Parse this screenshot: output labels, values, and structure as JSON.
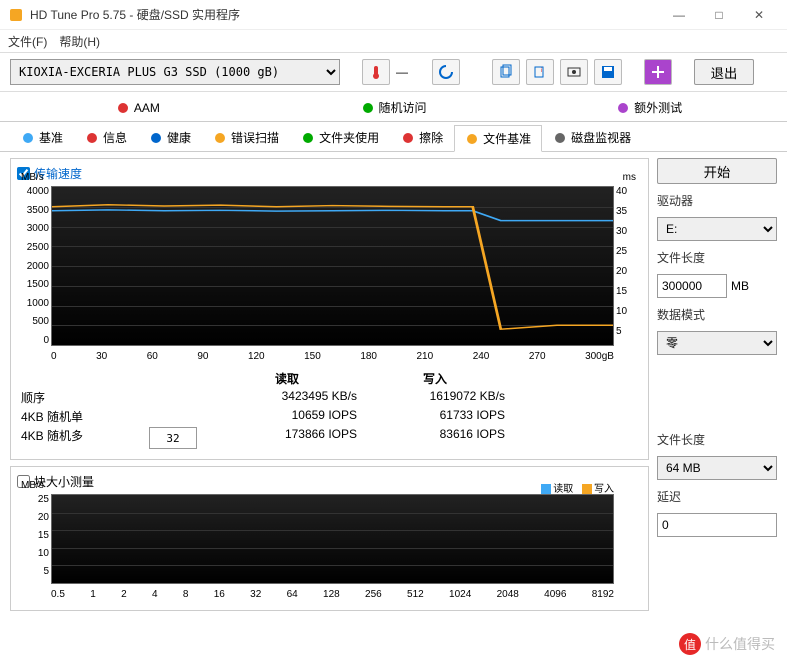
{
  "window": {
    "title": "HD Tune Pro 5.75 - 硬盘/SSD 实用程序",
    "min": "—",
    "max": "□",
    "close": "✕"
  },
  "menu": {
    "file": "文件(F)",
    "help": "帮助(H)"
  },
  "toolbar": {
    "drive": "KIOXIA-EXCERIA PLUS G3 SSD (1000 gB)",
    "exit": "退出"
  },
  "tabs_row1": [
    {
      "icon": "speaker-icon",
      "label": "AAM"
    },
    {
      "icon": "random-icon",
      "label": "随机访问"
    },
    {
      "icon": "extra-icon",
      "label": "额外测试"
    }
  ],
  "tabs_row2": [
    {
      "icon": "bulb-icon",
      "label": "基准"
    },
    {
      "icon": "info-icon",
      "label": "信息"
    },
    {
      "icon": "health-icon",
      "label": "健康"
    },
    {
      "icon": "scan-icon",
      "label": "错误扫描"
    },
    {
      "icon": "folder-icon",
      "label": "文件夹使用"
    },
    {
      "icon": "erase-icon",
      "label": "擦除"
    },
    {
      "icon": "filebench-icon",
      "label": "文件基准",
      "active": true
    },
    {
      "icon": "monitor-icon",
      "label": "磁盘监视器"
    }
  ],
  "panel1": {
    "checkbox": "传输速度",
    "unit_left": "MB/s",
    "unit_right": "ms",
    "yaxis_left": [
      "4000",
      "3500",
      "3000",
      "2500",
      "2000",
      "1500",
      "1000",
      "500",
      "0"
    ],
    "yaxis_right": [
      "40",
      "35",
      "30",
      "25",
      "20",
      "15",
      "10",
      "5",
      ""
    ],
    "xaxis": [
      "0",
      "30",
      "60",
      "90",
      "120",
      "150",
      "180",
      "210",
      "240",
      "270",
      "300gB"
    ]
  },
  "results": {
    "hdr_read": "读取",
    "hdr_write": "写入",
    "rows": [
      {
        "name": "顺序",
        "read": "3423495 KB/s",
        "write": "1619072 KB/s"
      },
      {
        "name": "4KB 随机单",
        "read": "10659 IOPS",
        "write": "61733 IOPS"
      },
      {
        "name": "4KB 随机多",
        "spinner": "32",
        "read": "173866 IOPS",
        "write": "83616 IOPS"
      }
    ]
  },
  "panel2": {
    "checkbox": "块大小测量",
    "unit_left": "MB/s",
    "legend_read": "读取",
    "legend_write": "写入",
    "yaxis_left": [
      "25",
      "20",
      "15",
      "10",
      "5",
      ""
    ],
    "xaxis": [
      "0.5",
      "1",
      "2",
      "4",
      "8",
      "16",
      "32",
      "64",
      "128",
      "256",
      "512",
      "1024",
      "2048",
      "4096",
      "8192"
    ]
  },
  "sidebar": {
    "start": "开始",
    "drive_label": "驱动器",
    "drive_value": "E:",
    "filelen_label": "文件长度",
    "filelen_value": "300000",
    "filelen_unit": "MB",
    "datamode_label": "数据模式",
    "datamode_value": "零",
    "filelen2_label": "文件长度",
    "filelen2_value": "64 MB",
    "delay_label": "延迟",
    "delay_value": "0"
  },
  "watermark": "什么值得买",
  "chart_data": {
    "type": "line",
    "title": "传输速度",
    "xlabel": "gB",
    "ylabel": "MB/s",
    "ylim": [
      0,
      4000
    ],
    "x": [
      0,
      30,
      60,
      90,
      120,
      150,
      180,
      210,
      225,
      240,
      270,
      300
    ],
    "series": [
      {
        "name": "读取",
        "color": "#3fa9f5",
        "values": [
          3400,
          3420,
          3400,
          3410,
          3390,
          3400,
          3410,
          3400,
          3400,
          3150,
          3150,
          3150
        ]
      },
      {
        "name": "写入",
        "color": "#f5a623",
        "values": [
          3500,
          3550,
          3520,
          3540,
          3500,
          3530,
          3510,
          3500,
          3500,
          400,
          500,
          500
        ]
      }
    ]
  }
}
